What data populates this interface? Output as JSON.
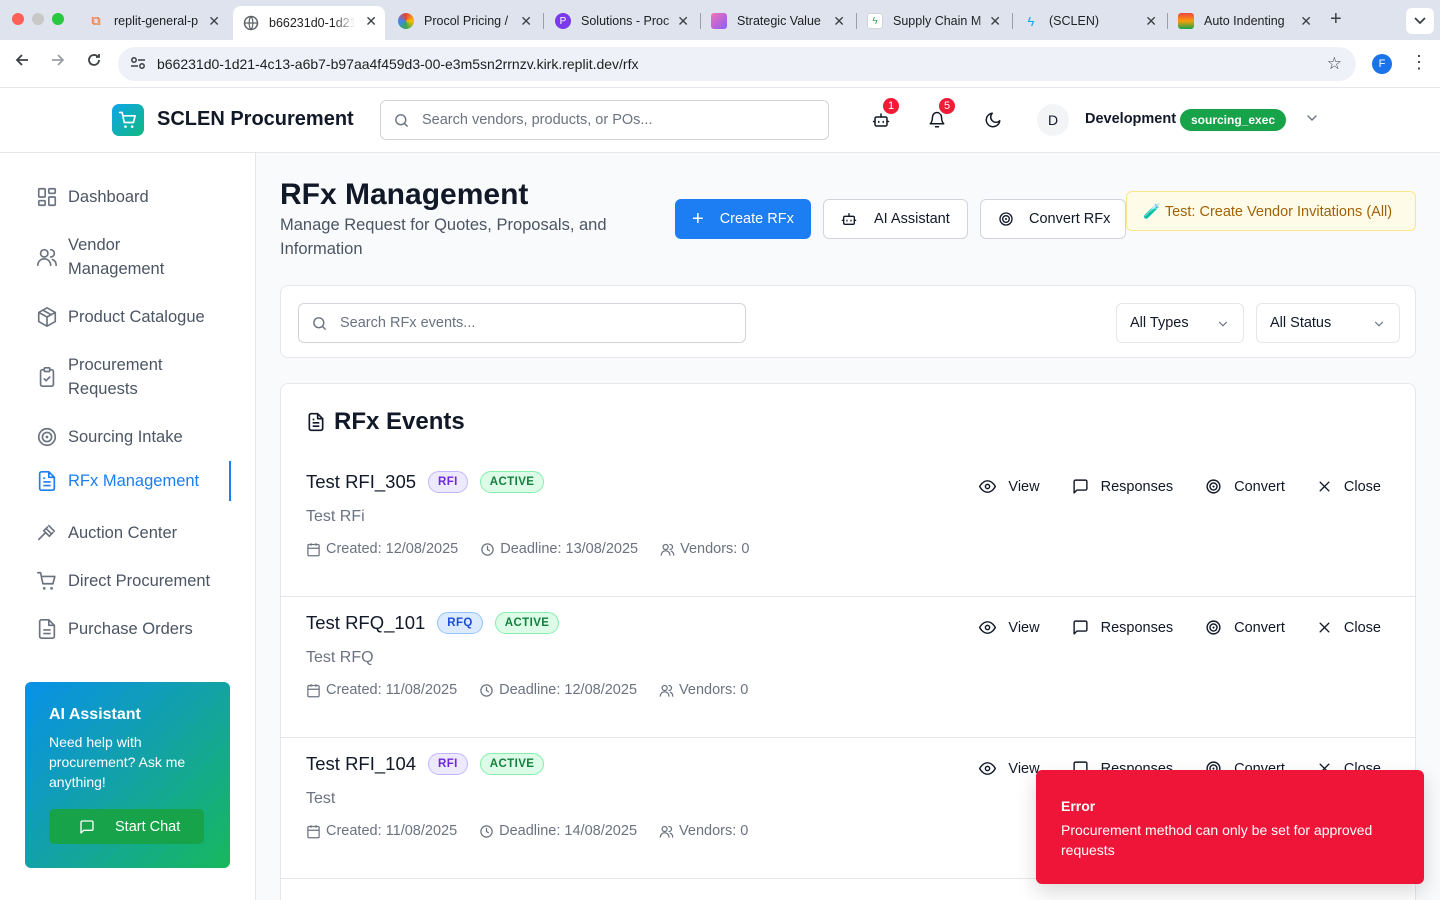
{
  "browser": {
    "tabs": [
      {
        "title": "replit-general-p",
        "color": "#f26207"
      },
      {
        "title": "b66231d0-1d21",
        "color": "#5f6368"
      },
      {
        "title": "Procol Pricing /",
        "color": "#ea4335"
      },
      {
        "title": "Solutions - Proc",
        "color": "#7c3aed"
      },
      {
        "title": "Strategic Value",
        "color": "#a855f7"
      },
      {
        "title": "Supply Chain M",
        "color": "#34a853"
      },
      {
        "title": "(SCLEN)",
        "color": "#0ea5e9"
      },
      {
        "title": "Auto Indenting",
        "color": "#16a34a"
      }
    ],
    "url": "b66231d0-1d21-4c13-a6b7-b97aa4f459d3-00-e3m5sn2rrnzv.kirk.replit.dev/rfx",
    "profile_initial": "F"
  },
  "header": {
    "app_name": "SCLEN Procurement",
    "search_placeholder": "Search vendors, products, or POs...",
    "bot_badge": "1",
    "bell_badge": "5",
    "avatar_initial": "D",
    "user_name": "Development",
    "role": "sourcing_exec"
  },
  "sidebar": {
    "items": [
      {
        "label": "Dashboard",
        "icon": "dashboard-icon"
      },
      {
        "label": "Vendor Management",
        "icon": "users-icon"
      },
      {
        "label": "Product Catalogue",
        "icon": "package-icon"
      },
      {
        "label": "Procurement Requests",
        "icon": "clipboard-check-icon"
      },
      {
        "label": "Sourcing Intake",
        "icon": "target-icon"
      },
      {
        "label": "RFx Management",
        "icon": "file-text-icon",
        "active": true
      },
      {
        "label": "Auction Center",
        "icon": "gavel-icon"
      },
      {
        "label": "Direct Procurement",
        "icon": "cart-icon"
      },
      {
        "label": "Purchase Orders",
        "icon": "document-icon"
      }
    ],
    "ai_card": {
      "title": "AI Assistant",
      "description": "Need help with procurement? Ask me anything!",
      "button": "Start Chat"
    }
  },
  "main": {
    "title": "RFx Management",
    "subtitle": "Manage Request for Quotes, Proposals, and Information",
    "buttons": {
      "create": "Create RFx",
      "ai": "AI Assistant",
      "convert": "Convert RFx",
      "test": "🧪 Test: Create Vendor Invitations (All)"
    },
    "filters": {
      "search_placeholder": "Search RFx events...",
      "type": "All Types",
      "status": "All Status"
    },
    "events_title": "RFx Events",
    "events": [
      {
        "name": "Test RFI_305",
        "type": "RFI",
        "status": "ACTIVE",
        "description": "Test RFi",
        "created": "Created: 12/08/2025",
        "deadline": "Deadline: 13/08/2025",
        "vendors": "Vendors: 0"
      },
      {
        "name": "Test RFQ_101",
        "type": "RFQ",
        "status": "ACTIVE",
        "description": "Test RFQ",
        "created": "Created: 11/08/2025",
        "deadline": "Deadline: 12/08/2025",
        "vendors": "Vendors: 0"
      },
      {
        "name": "Test RFI_104",
        "type": "RFI",
        "status": "ACTIVE",
        "description": "Test",
        "created": "Created: 11/08/2025",
        "deadline": "Deadline: 14/08/2025",
        "vendors": "Vendors: 0"
      }
    ],
    "actions": {
      "view": "View",
      "responses": "Responses",
      "convert": "Convert",
      "close": "Close"
    }
  },
  "toast": {
    "title": "Error",
    "message": "Procurement method can only be set for approved requests",
    "color": "#ef1538"
  }
}
